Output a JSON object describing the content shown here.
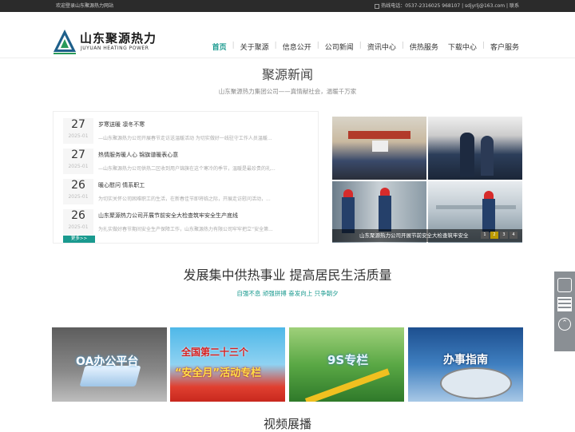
{
  "topbar": {
    "welcome": "欢迎登录山东聚源热力网站",
    "contact": "热线电话：0537-2316025 968107 | sdjyrlj@163.com | 联系"
  },
  "logo": {
    "cn": "山东聚源热力",
    "en": "JUYUAN HEATING POWER"
  },
  "nav": [
    {
      "label": "首页",
      "active": true
    },
    {
      "label": "关于聚源"
    },
    {
      "label": "信息公开"
    },
    {
      "label": "公司新闻"
    },
    {
      "label": "资讯中心"
    },
    {
      "label": "供热服务"
    },
    {
      "label": "下载中心"
    },
    {
      "label": "客户服务"
    }
  ],
  "news": {
    "title": "聚源新闻",
    "subtitle": "山东聚源热力集团公司——真情献社会，温暖千万家",
    "items": [
      {
        "day": "27",
        "ym": "2025-01",
        "title": "岁寒送暖 凛冬不寒",
        "desc": "—山东聚源热力公司开展春节走访送温暖活动 为切实做好一线驻守工作人员温暖..."
      },
      {
        "day": "27",
        "ym": "2025-01",
        "title": "热情服务暖人心 锦旗谱暖表心意",
        "desc": "—山东聚源热力公司供热二区收到用户锦旗在这个寒冷的季节，温暖是最珍贵的礼..."
      },
      {
        "day": "26",
        "ym": "2025-01",
        "title": "暖心慰问  情系职工",
        "desc": "为切实关怀公司困难职工的生活，在新春佳节即将临之际，开展走访慰问活动，..."
      },
      {
        "day": "26",
        "ym": "2025-01",
        "title": "山东聚源热力公司开展节前安全大检查筑牢安全生产底线",
        "desc": "为扎实做好春节期间安全生产保障工作，山东聚源热力有限公司牢牢把立“安全第..."
      }
    ],
    "more": "更多>>",
    "caption": "山东聚源热力公司开展节前安全大检查筑牢安全",
    "dots": [
      "1",
      "2",
      "3",
      "4"
    ]
  },
  "mission": {
    "title": "发展集中供热事业 提高居民生活质量",
    "subtitle": "自强不息 顽强拼搏 奋发向上 只争朝夕"
  },
  "banners": [
    {
      "label": "OA办公平台"
    },
    {
      "label1": "全国第二十三个",
      "label2": "“安全月”活动专栏"
    },
    {
      "label": "9S专栏"
    },
    {
      "label": "办事指南"
    }
  ],
  "video": {
    "title": "视频展播"
  },
  "colors": {
    "accent": "#1a9a8f",
    "topbar": "#2b2b2b"
  }
}
